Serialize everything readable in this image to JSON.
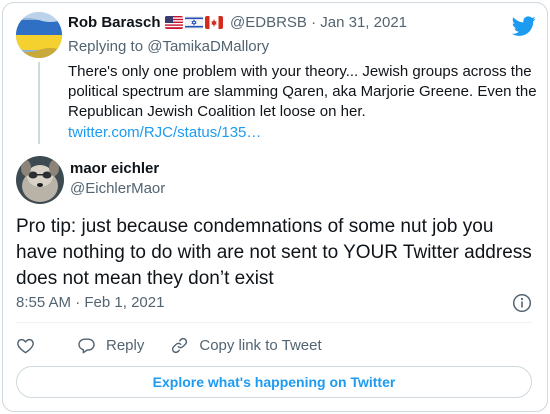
{
  "parent_tweet": {
    "name": "Rob Barasch",
    "flags": [
      "us-flag",
      "israel-flag",
      "canada-flag"
    ],
    "handle": "@EDBRSB",
    "separator": "·",
    "date": "Jan 31, 2021",
    "replying_label": "Replying to",
    "replying_to": "@TamikaDMallory",
    "text": "There's only one problem with your theory... Jewish groups across the political spectrum are slamming Qaren, aka Marjorie Greene. Even the Republican Jewish Coalition let loose on her.",
    "link": "twitter.com/RJC/status/135…"
  },
  "main_tweet": {
    "name": "maor eichler",
    "handle": "@EichlerMaor",
    "text": "Pro tip: just because condemnations of some nut job you have nothing to do with are not sent to YOUR Twitter address does not mean they don’t exist",
    "time": "8:55 AM",
    "separator": "·",
    "date": "Feb 1, 2021"
  },
  "actions": {
    "like_icon": "heart-icon",
    "reply_label": "Reply",
    "copy_label": "Copy link to Tweet"
  },
  "explore_label": "Explore what's happening on Twitter",
  "colors": {
    "accent": "#1d9bf0",
    "secondary_text": "#536471",
    "border": "#cfd9de"
  }
}
